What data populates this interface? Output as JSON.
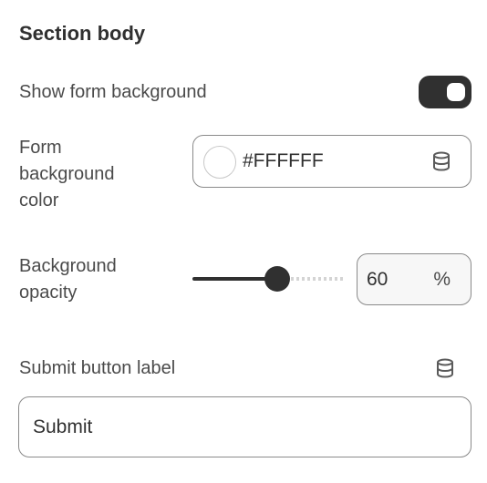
{
  "section": {
    "title": "Section body"
  },
  "show_form_background": {
    "label": "Show form background",
    "enabled": true
  },
  "form_background_color": {
    "label_lines": [
      "Form",
      "background",
      "color"
    ],
    "value": "#FFFFFF",
    "swatch_color": "#FFFFFF",
    "dynamic_source_icon": "database-icon"
  },
  "background_opacity": {
    "label_lines": [
      "Background",
      "opacity"
    ],
    "value": "60",
    "suffix": "%",
    "slider_fraction": 0.6
  },
  "submit_button_label": {
    "label": "Submit button label",
    "value": "Submit",
    "dynamic_source_icon": "database-icon"
  },
  "colors": {
    "accent": "#303030",
    "border": "#8a8a8a",
    "text": "#303030"
  }
}
